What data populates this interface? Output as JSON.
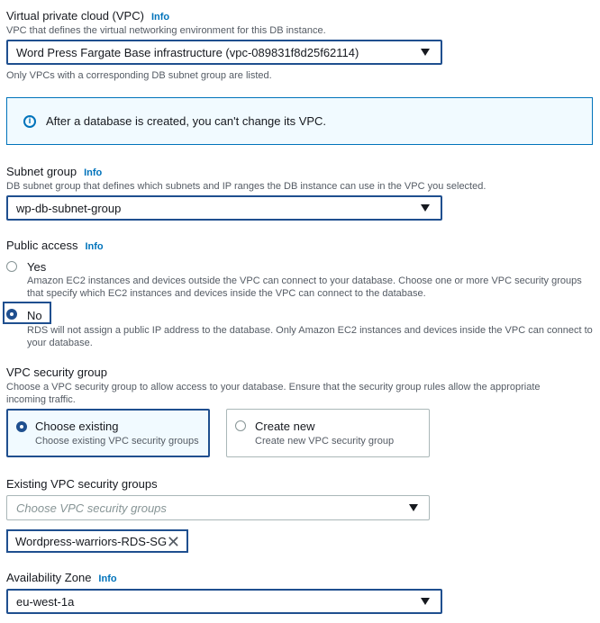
{
  "vpc": {
    "label": "Virtual private cloud (VPC)",
    "info": "Info",
    "description": "VPC that defines the virtual networking environment for this DB instance.",
    "selected": "Word Press Fargate Base infrastructure (vpc-089831f8d25f62114)",
    "hint": "Only VPCs with a corresponding DB subnet group are listed.",
    "alert": "After a database is created, you can't change its VPC.",
    "alert_icon": "info-icon"
  },
  "subnet": {
    "label": "Subnet group",
    "info": "Info",
    "description": "DB subnet group that defines which subnets and IP ranges the DB instance can use in the VPC you selected.",
    "selected": "wp-db-subnet-group"
  },
  "public_access": {
    "label": "Public access",
    "info": "Info",
    "options": [
      {
        "label": "Yes",
        "description": "Amazon EC2 instances and devices outside the VPC can connect to your database. Choose one or more VPC security groups that specify which EC2 instances and devices inside the VPC can connect to the database.",
        "checked": false
      },
      {
        "label": "No",
        "description": "RDS will not assign a public IP address to the database. Only Amazon EC2 instances and devices inside the VPC can connect to your database.",
        "checked": true
      }
    ]
  },
  "security_group": {
    "label": "VPC security group",
    "description": "Choose a VPC security group to allow access to your database. Ensure that the security group rules allow the appropriate incoming traffic.",
    "options": [
      {
        "title": "Choose existing",
        "description": "Choose existing VPC security groups",
        "checked": true
      },
      {
        "title": "Create new",
        "description": "Create new VPC security group",
        "checked": false
      }
    ]
  },
  "existing_groups": {
    "label": "Existing VPC security groups",
    "placeholder": "Choose VPC security groups",
    "token": "Wordpress-warriors-RDS-SG",
    "token_remove": "✕"
  },
  "az": {
    "label": "Availability Zone",
    "info": "Info",
    "selected": "eu-west-1a"
  },
  "colors": {
    "accent": "#1f4f8f",
    "link": "#0073bb",
    "alert_bg": "#f1faff"
  }
}
